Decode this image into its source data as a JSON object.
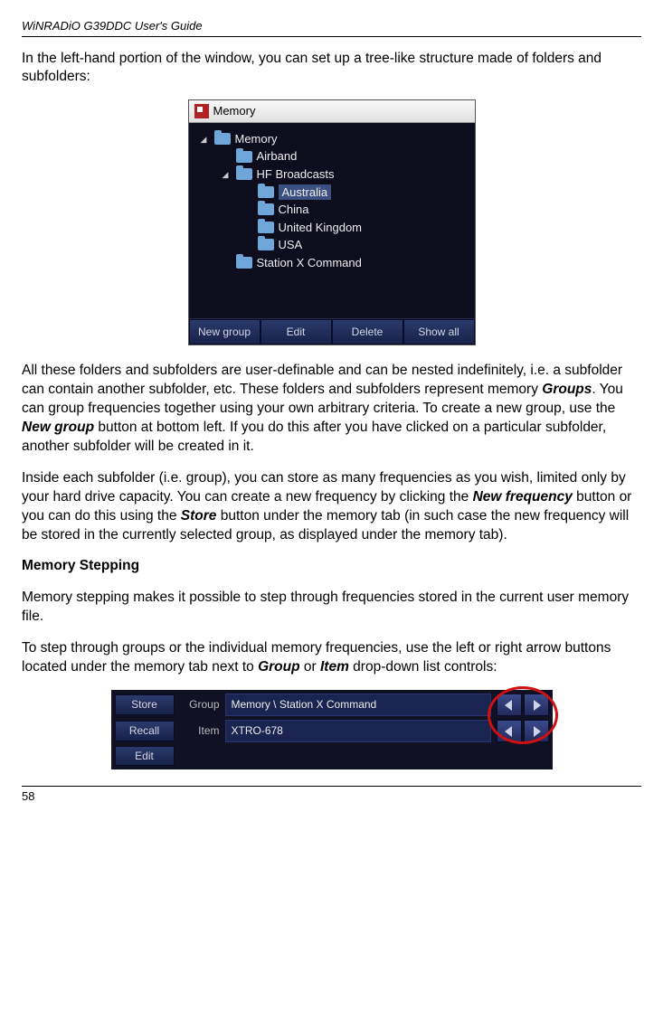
{
  "header": "WiNRADiO G39DDC User's Guide",
  "para1": "In the left-hand portion of the window, you can set up a tree-like structure made of folders and subfolders:",
  "memoryWindow": {
    "title": "Memory",
    "tree": {
      "root": "Memory",
      "items": [
        "Airband",
        "HF Broadcasts",
        "Station X Command"
      ],
      "hfChildren": [
        "Australia",
        "China",
        "United Kingdom",
        "USA"
      ]
    },
    "buttons": {
      "newGroup": "New group",
      "edit": "Edit",
      "delete": "Delete",
      "showAll": "Show all"
    }
  },
  "para2_a": "All these folders and subfolders are user-definable and can be nested indefinitely, i.e. a subfolder can contain another subfolder, etc. These folders and subfolders represent memory ",
  "para2_groups": "Groups",
  "para2_b": ". You can group frequencies together using your own arbitrary criteria. To create a new group, use the ",
  "para2_newgroup": "New group",
  "para2_c": " button at bottom left. If you do this after you have clicked on a particular subfolder, another subfolder will be created in it.",
  "para3_a": "Inside each subfolder (i.e. group), you can store as many frequencies as you wish, limited only by your hard drive capacity. You can create a new frequency by clicking the ",
  "para3_newfreq": "New frequency",
  "para3_b": " button or you can do this using the ",
  "para3_store": "Store",
  "para3_c": " button under the memory tab (in such case the new frequency will be stored in the currently selected group, as displayed under the memory tab).",
  "heading": "Memory Stepping",
  "para4": "Memory stepping makes it possible to step through frequencies stored in the current user memory file.",
  "para5_a": "To step through groups or the individual memory frequencies, use the left or right arrow buttons located under the memory tab next to ",
  "para5_group": "Group",
  "para5_b": " or ",
  "para5_item": "Item",
  "para5_c": " drop-down list controls:",
  "stepper": {
    "store": "Store",
    "recall": "Recall",
    "edit": "Edit",
    "groupLabel": "Group",
    "groupValue": "Memory \\ Station X Command",
    "itemLabel": "Item",
    "itemValue": "XTRO-678"
  },
  "pageNumber": "58"
}
